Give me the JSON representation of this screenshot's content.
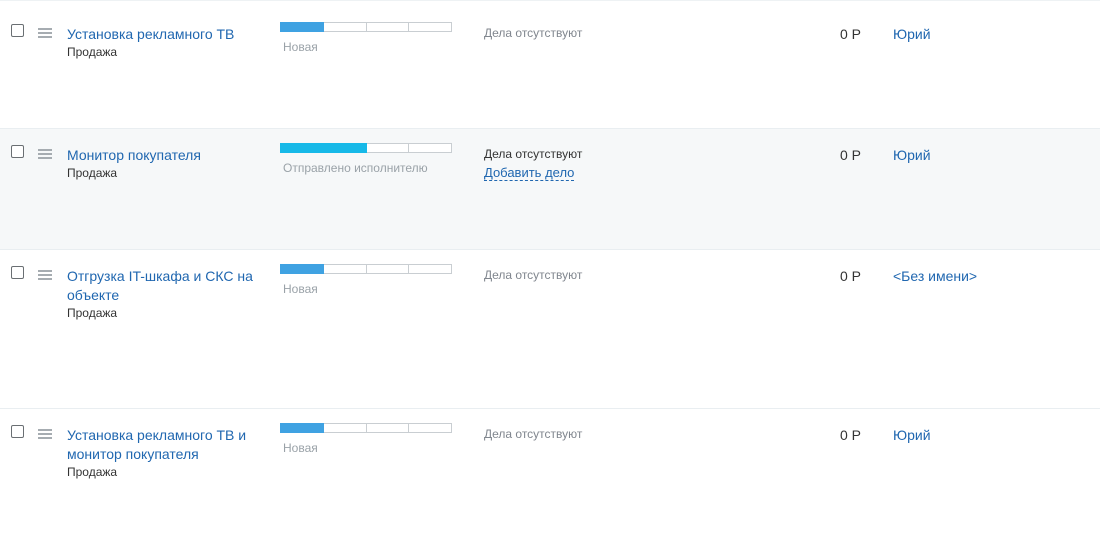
{
  "colors": {
    "stage_new_fill": "#3fa2e2",
    "stage_sent_fill": "#17b9e8",
    "link": "#2067b0",
    "row_highlight": "#f6f8f9"
  },
  "progress_segments": 4,
  "deals": [
    {
      "title": "Установка рекламного ТВ",
      "category": "Продажа",
      "stage": "Новая",
      "stage_fraction": 0.25,
      "activities": "Дела отсутствуют",
      "add_activity": "",
      "sum": "0 Р",
      "responsible": "Юрий"
    },
    {
      "title": "Монитор покупателя",
      "category": "Продажа",
      "stage": "Отправлено исполнителю",
      "stage_fraction": 0.5,
      "activities": "Дела отсутствуют",
      "add_activity": "Добавить дело",
      "sum": "0 Р",
      "responsible": "Юрий"
    },
    {
      "title": "Отгрузка IT-шкафа и СКС на объекте",
      "category": "Продажа",
      "stage": "Новая",
      "stage_fraction": 0.25,
      "activities": "Дела отсутствуют",
      "add_activity": "",
      "sum": "0 Р",
      "responsible": "<Без имени>"
    },
    {
      "title": "Установка рекламного ТВ и монитор покупателя",
      "category": "Продажа",
      "stage": "Новая",
      "stage_fraction": 0.25,
      "activities": "Дела отсутствуют",
      "add_activity": "",
      "sum": "0 Р",
      "responsible": "Юрий"
    }
  ]
}
